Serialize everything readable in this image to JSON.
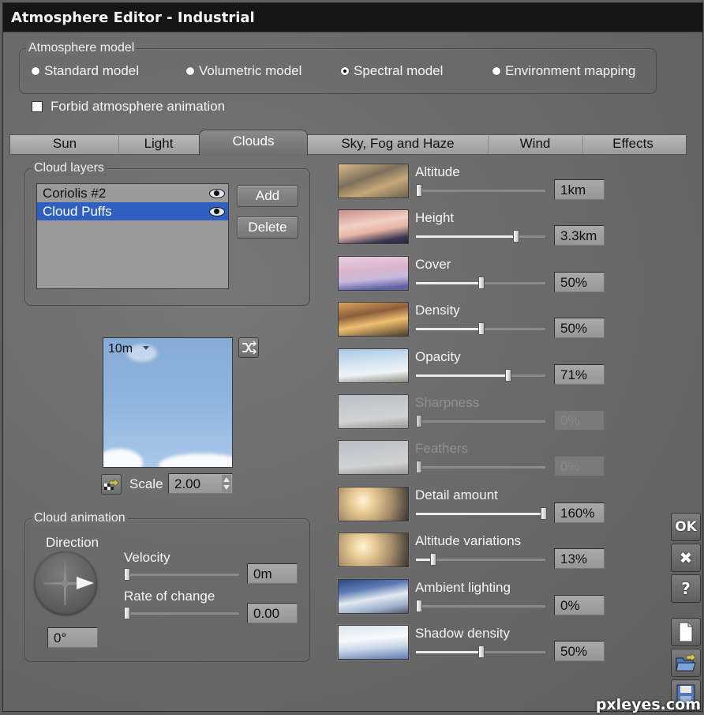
{
  "window": {
    "title": "Atmosphere Editor - Industrial"
  },
  "atmosphere_model": {
    "legend": "Atmosphere model",
    "options": [
      {
        "label": "Standard model",
        "selected": false
      },
      {
        "label": "Volumetric model",
        "selected": false
      },
      {
        "label": "Spectral model",
        "selected": true
      },
      {
        "label": "Environment mapping",
        "selected": false
      }
    ]
  },
  "forbid_animation": {
    "label": "Forbid atmosphere animation",
    "checked": false
  },
  "tabs": [
    {
      "label": "Sun",
      "active": false
    },
    {
      "label": "Light",
      "active": false
    },
    {
      "label": "Clouds",
      "active": true
    },
    {
      "label": "Sky, Fog and Haze",
      "active": false
    },
    {
      "label": "Wind",
      "active": false
    },
    {
      "label": "Effects",
      "active": false
    }
  ],
  "cloud_layers": {
    "legend": "Cloud layers",
    "items": [
      {
        "name": "Coriolis #2",
        "visible": true,
        "selected": false,
        "icon": "eye-icon"
      },
      {
        "name": "Cloud Puffs",
        "visible": true,
        "selected": true,
        "icon": "eye-icon"
      }
    ],
    "add_label": "Add",
    "delete_label": "Delete",
    "selection_color": "#2f5fc0"
  },
  "preview": {
    "altitude_label": "10m",
    "randomize_icon": "shuffle-icon",
    "material_icon": "checker-arrow-icon",
    "scale_label": "Scale",
    "scale_value": "2.00"
  },
  "cloud_animation": {
    "legend": "Cloud animation",
    "direction_label": "Direction",
    "direction_value": "0°",
    "velocity": {
      "label": "Velocity",
      "value": "0m",
      "fraction": 0.0
    },
    "rate_of_change": {
      "label": "Rate of change",
      "value": "0.00",
      "fraction": 0.0
    }
  },
  "params": [
    {
      "label": "Altitude",
      "value": "1km",
      "fraction": 0.0,
      "disabled": false,
      "thumb": "warm"
    },
    {
      "label": "Height",
      "value": "3.3km",
      "fraction": 0.77,
      "disabled": false,
      "thumb": "pink"
    },
    {
      "label": "Cover",
      "value": "50%",
      "fraction": 0.5,
      "disabled": false,
      "thumb": "lavender"
    },
    {
      "label": "Density",
      "value": "50%",
      "fraction": 0.5,
      "disabled": false,
      "thumb": "sunset"
    },
    {
      "label": "Opacity",
      "value": "71%",
      "fraction": 0.71,
      "disabled": false,
      "thumb": "blue"
    },
    {
      "label": "Sharpness",
      "value": "0%",
      "fraction": 0.0,
      "disabled": true,
      "thumb": "pale"
    },
    {
      "label": "Feathers",
      "value": "0%",
      "fraction": 0.0,
      "disabled": true,
      "thumb": "pale"
    },
    {
      "label": "Detail amount",
      "value": "160%",
      "fraction": 1.0,
      "disabled": false,
      "thumb": "sun"
    },
    {
      "label": "Altitude variations",
      "value": "13%",
      "fraction": 0.13,
      "disabled": false,
      "thumb": "sun"
    },
    {
      "label": "Ambient lighting",
      "value": "0%",
      "fraction": 0.0,
      "disabled": false,
      "thumb": "deepblue"
    },
    {
      "label": "Shadow density",
      "value": "50%",
      "fraction": 0.5,
      "disabled": false,
      "thumb": "white"
    }
  ],
  "side_buttons": [
    {
      "label": "OK",
      "icon": "ok-icon"
    },
    {
      "label": "✖",
      "icon": "close-icon"
    },
    {
      "label": "?",
      "icon": "help-icon"
    },
    {
      "label": "",
      "icon": "new-document-icon"
    },
    {
      "label": "",
      "icon": "open-folder-icon"
    },
    {
      "label": "",
      "icon": "save-disk-icon"
    }
  ],
  "watermark": "pxleyes.com"
}
